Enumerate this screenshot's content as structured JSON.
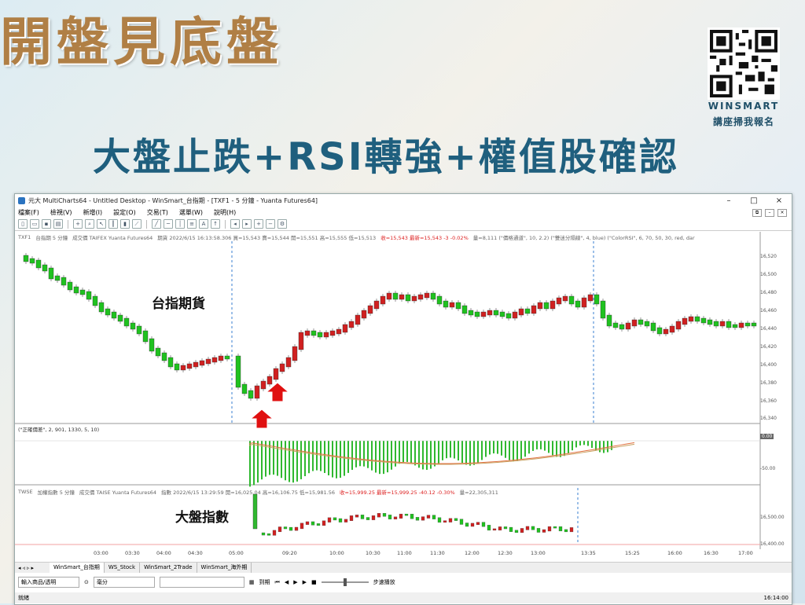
{
  "banner": {
    "title": "開盤見底盤",
    "subtitle": "大盤止跌+RSI轉強+權值股確認",
    "qr_brand": "WINSMART",
    "qr_caption": "講座掃我報名"
  },
  "window": {
    "title": "元大 MultiCharts64 - Untitled Desktop - WinSmart_台指期 - [TXF1 - 5 分鐘 - Yuanta Futures64]",
    "controls": [
      "–",
      "□",
      "×"
    ]
  },
  "menu": [
    "檔案(F)",
    "檢視(V)",
    "新增(I)",
    "設定(O)",
    "交易(T)",
    "選單(W)",
    "說明(H)"
  ],
  "main_chart": {
    "status_prefix": "TXF1",
    "status_symbol": "台指期  5 分鐘",
    "status_source": "成交價  TAIFEX  Yuanta Futures64",
    "status_values": "期貨  2022/6/15  16:13:58.306  買=15,543  賣=15,544  開=15,551  高=15,555  低=15,513",
    "status_close": "收=15,543  最新=15,543  -3  -0.02%",
    "status_tail": "量=8,111  (\"價格通道\", 10, 2.2)  (\"雙迷分隔線\", 4, blue)  (\"ColorRSI\", 6, 70, 50, 30, red, dar",
    "annotation": "台指期貨",
    "price_ticks": [
      "16,520",
      "16,500",
      "16,480",
      "16,460",
      "16,440",
      "16,420",
      "16,400",
      "16,380",
      "16,360",
      "16,340"
    ]
  },
  "indicator": {
    "label": "(\"正確價差\", 2, 901, 1330, 5, 10)",
    "ticks": [
      "0.00",
      "-50.00"
    ]
  },
  "index_chart": {
    "status_prefix": "TWSE",
    "status_symbol": "加權指數  5 分鐘",
    "status_source": "成交價  TAISE  Yuanta Futures64",
    "status_values": "指數  2022/6/15  13:29:59  開=16,025.04  高=16,106.75  低=15,981.56",
    "status_close": "收=15,999.25  最新=15,999.25  -40.12  -0.30%",
    "status_tail": "量=22,305,311",
    "annotation": "大盤指數",
    "ticks": [
      "16,500.00",
      "16,400.00"
    ]
  },
  "time_axis": [
    "03:00",
    "03:30",
    "04:00",
    "04:30",
    "05:00",
    "09:20",
    "10:00",
    "10:30",
    "11:00",
    "11:30",
    "12:00",
    "12:30",
    "13:00",
    "13:35",
    "15:25",
    "16:00",
    "16:30",
    "17:00"
  ],
  "tabs": [
    "WinSmart_台指期",
    "WS_Stock",
    "WinSmart_2Trade",
    "WinSmart_海外期"
  ],
  "bottom": {
    "symbol_placeholder": "輸入商品/透明",
    "interval": "毫分",
    "mode": "到期",
    "speed_label": "步速播放"
  },
  "statusbar": {
    "left": "就緒",
    "right": "16:14:00"
  },
  "colors": {
    "up": "#d02020",
    "down": "#1fc21f",
    "arrow": "#e01010",
    "title_gold": "#b07f45",
    "subtitle_blue": "#1f5f7e"
  }
}
